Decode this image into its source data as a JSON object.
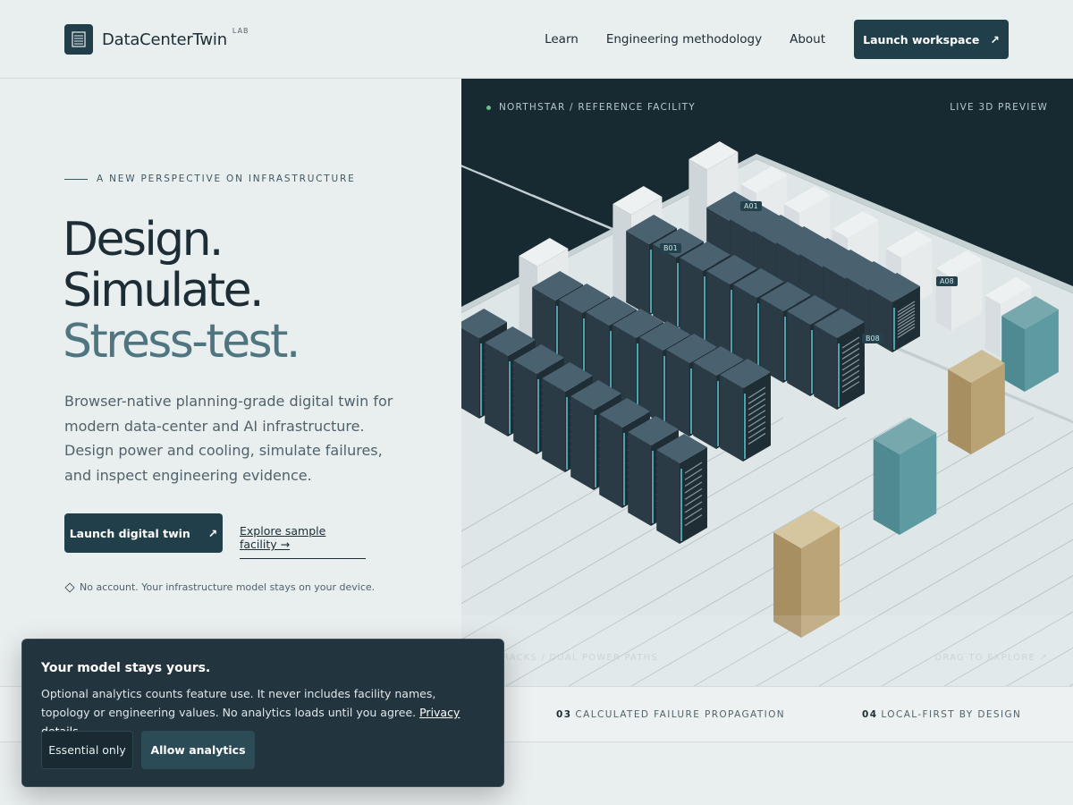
{
  "brand": {
    "name": "DataCenterTwin",
    "tag": "LAB"
  },
  "nav": {
    "learn": "Learn",
    "methodology": "Engineering methodology",
    "about": "About",
    "launch": "Launch workspace",
    "launch_icon": "↗"
  },
  "hero": {
    "eyebrow": "A NEW PERSPECTIVE ON INFRASTRUCTURE",
    "line1": "Design.",
    "line2": "Simulate.",
    "line3": "Stress-test.",
    "lede": "Browser-native planning-grade digital twin for modern data-center and AI infrastructure. Design power and cooling, simulate failures, and inspect engineering evidence.",
    "primary": "Launch digital twin",
    "primary_icon": "↗",
    "secondary": "Explore sample facility →",
    "note": "No account. Your infrastructure model stays on your device."
  },
  "scene": {
    "label_left": "NORTHSTAR / REFERENCE FACILITY",
    "label_right": "LIVE 3D PREVIEW",
    "foot_left": "RACKS   /   DUAL POWER PATHS",
    "foot_right": "DRAG TO EXPLORE ↗",
    "tags": {
      "a01": "A01",
      "b01": "B01",
      "a08": "A08",
      "b08": "B08"
    }
  },
  "features": [
    {
      "num": "03",
      "label": "CALCULATED FAILURE PROPAGATION"
    },
    {
      "num": "04",
      "label": "LOCAL-FIRST BY DESIGN"
    }
  ],
  "cookie": {
    "title": "Your model stays yours.",
    "body": "Optional analytics counts feature use. It never includes facility names, topology or engineering values. No analytics loads until you agree.",
    "link": "Privacy details",
    "essential": "Essential only",
    "allow": "Allow analytics"
  },
  "colors": {
    "primary": "#213e4b",
    "accent_teal": "#4e7580",
    "scene_bg": "#172a32",
    "floor": "#dfe6e8"
  }
}
